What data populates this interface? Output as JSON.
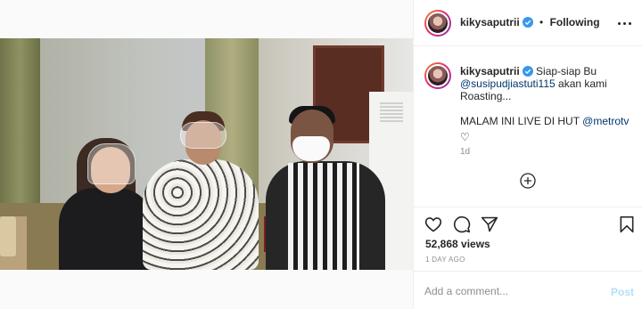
{
  "post": {
    "username": "kikysaputrii",
    "follow_state": "Following",
    "separator": "•",
    "caption": {
      "line1": "Siap-siap Bu",
      "mention1": "@susipudjiastuti115",
      "line2_rest": " akan kami",
      "line3": "Roasting...",
      "line4": "MALAM INI LIVE DI HUT ",
      "mention2": "@metrotv",
      "emoji": "♡"
    },
    "caption_time": "1d",
    "views": "52,868 views",
    "posted": "1 DAY AGO"
  },
  "comment": {
    "placeholder": "Add a comment...",
    "post_label": "Post"
  },
  "colors": {
    "verified": "#3897f0",
    "mention": "#00376b",
    "post_disabled": "#b2dffc",
    "muted_text": "#8e8e8e"
  },
  "icons": {
    "verified": "verified-badge-icon",
    "more": "more-options-icon",
    "like": "heart-icon",
    "comment": "comment-bubble-icon",
    "share": "paper-plane-icon",
    "save": "bookmark-icon",
    "add": "plus-circle-icon",
    "tag": "user-tag-icon",
    "mute": "speaker-muted-icon"
  }
}
